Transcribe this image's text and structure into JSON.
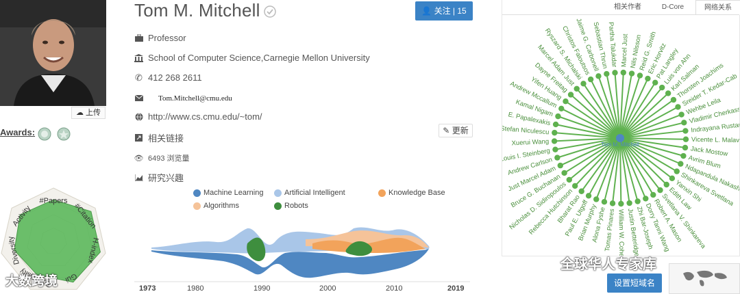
{
  "profile": {
    "name": "Tom M. Mitchell",
    "upload_label": "上传",
    "awards_label": "Awards:",
    "follow_label": "关注 | 15",
    "title": "Professor",
    "affiliation": "School of Computer Science,Carnegie Mellon University",
    "phone": "412 268 2611",
    "email": "Tom.Mitchell@cmu.edu",
    "homepage": "http://www.cs.cmu.edu/~tom/",
    "related_links": "相关链接",
    "update_label": "更新",
    "views": "6493 浏览量",
    "research_interests": "研究兴趣"
  },
  "radar": {
    "axes": [
      "#Papers",
      "#Citation",
      "H-index",
      "Gui",
      "Sociability",
      "Diversity",
      "Activity"
    ],
    "values": [
      0.78,
      0.9,
      0.9,
      0.85,
      0.7,
      0.75,
      0.8
    ]
  },
  "legend": [
    {
      "name": "Machine Learning",
      "color": "#4f87c2"
    },
    {
      "name": "Artificial Intelligent",
      "color": "#a9c6e8"
    },
    {
      "name": "Knowledge Base",
      "color": "#f2a35b"
    },
    {
      "name": "Algorithms",
      "color": "#f5c399"
    },
    {
      "name": "Robots",
      "color": "#3e8e3e"
    }
  ],
  "timeline": {
    "start": "1973",
    "end": "2019",
    "ticks": [
      "1980",
      "1990",
      "2000",
      "2010"
    ]
  },
  "tabs": [
    "相关作者",
    "D-Core",
    "网络关系"
  ],
  "active_tab": 2,
  "network": {
    "center": "Tom M. Mitchell",
    "nodes": [
      "Marcel Just",
      "Nils Nilsson",
      "Reid G. Smith",
      "Eric Horvitz",
      "Pat Langley",
      "Luis von Ahn",
      "Karl Salman",
      "Thorsten Joachims",
      "Sreider T. Kedar-Cab",
      "Wehbe Leila",
      "Vladimir Cherkassky",
      "Indrayana Rustandi",
      "Vicente L. Malave",
      "Jack Mostow",
      "Avrim Blum",
      "Ndapandula Nakashole",
      "Shinkareva Svetlana",
      "Yanxin Shi",
      "Edith Law",
      "Svetlana V. Shinkareva",
      "Robert A. Mason",
      "Dorry Tanni Wang",
      "Zhi Bar-Joseph",
      "Justin Betteridge",
      "William W. Cohen",
      "Tomas Pinares",
      "Alona Fyshe",
      "Brian Murphy",
      "Paul E. Utgoff",
      "Bharat Rao",
      "Rebecca Hutchinson",
      "Nicholas D. Sidiropoulos",
      "Bruce G. Buchanan",
      "Just Marcel Adam",
      "Andrew Carlson",
      "Louis I. Steinberg",
      "Xuerui Wang",
      "Stefan Niculescu",
      "E. Papalexakis",
      "Kamal Nigam",
      "Andrew Mccallum",
      "Yifen Huang",
      "Dayne Freitag",
      "Marcel Adam Just",
      "Ryszard S. Michalski",
      "Christos Faloutsos",
      "Jaime G. Carbonell",
      "Sebastian Thrun",
      "Partha Talukdar"
    ]
  },
  "buttons": {
    "set_domain": "设置短域名"
  },
  "watermarks": [
    "全球华人专家库",
    "大数跨境"
  ]
}
